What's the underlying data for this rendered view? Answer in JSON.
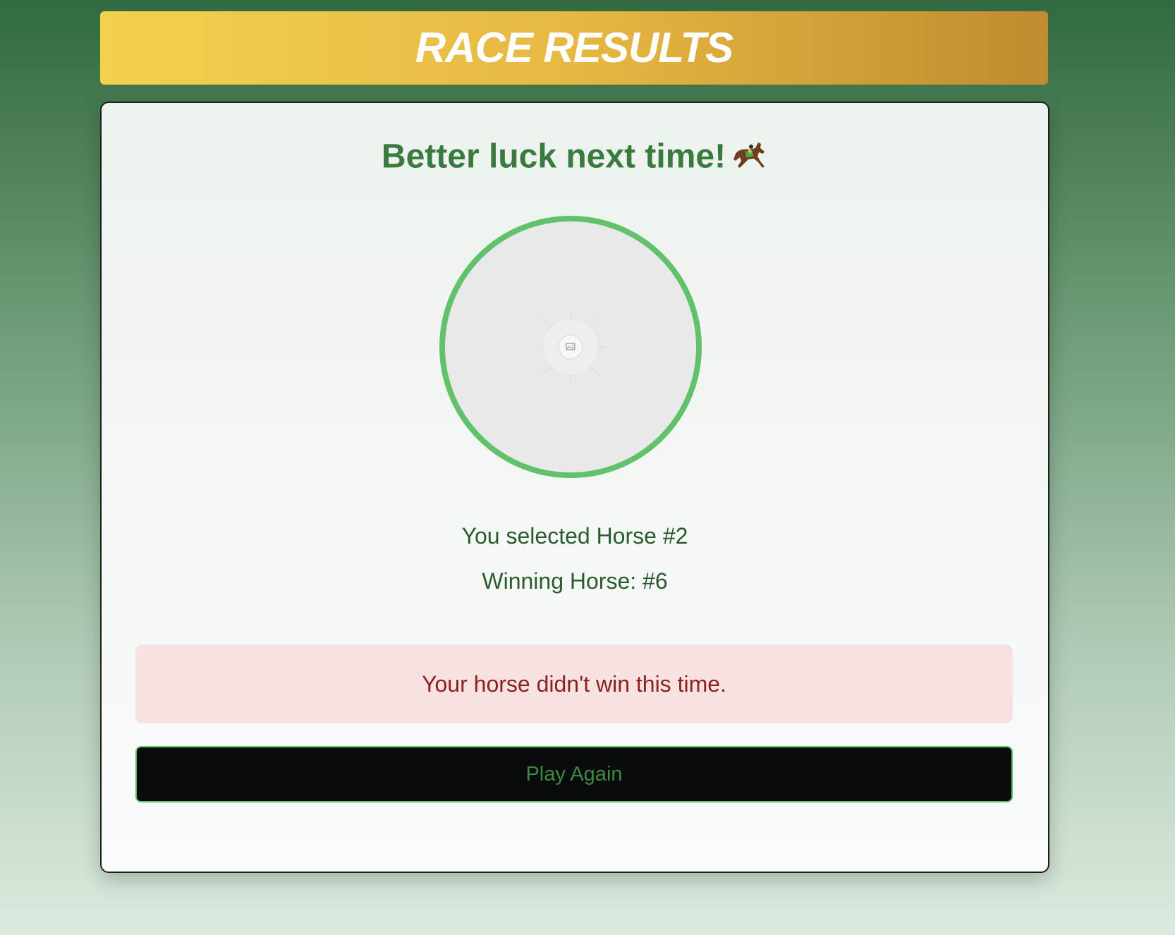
{
  "header": {
    "title": "RACE RESULTS"
  },
  "result": {
    "heading": "Better luck next time!",
    "heading_icon": "horse-racing-icon",
    "image_placeholder_icon": "image-placeholder-icon",
    "selected_text": "You selected Horse #2",
    "winner_text": "Winning Horse: #6",
    "alert_text": "Your horse didn't win this time.",
    "play_again_label": "Play Again"
  },
  "colors": {
    "accent_green": "#62c26b",
    "heading_green": "#3a7a3f",
    "alert_bg": "#f8e1e1",
    "alert_text": "#8b2221",
    "banner_gold_start": "#f2d14f",
    "banner_gold_end": "#c08b2f"
  }
}
